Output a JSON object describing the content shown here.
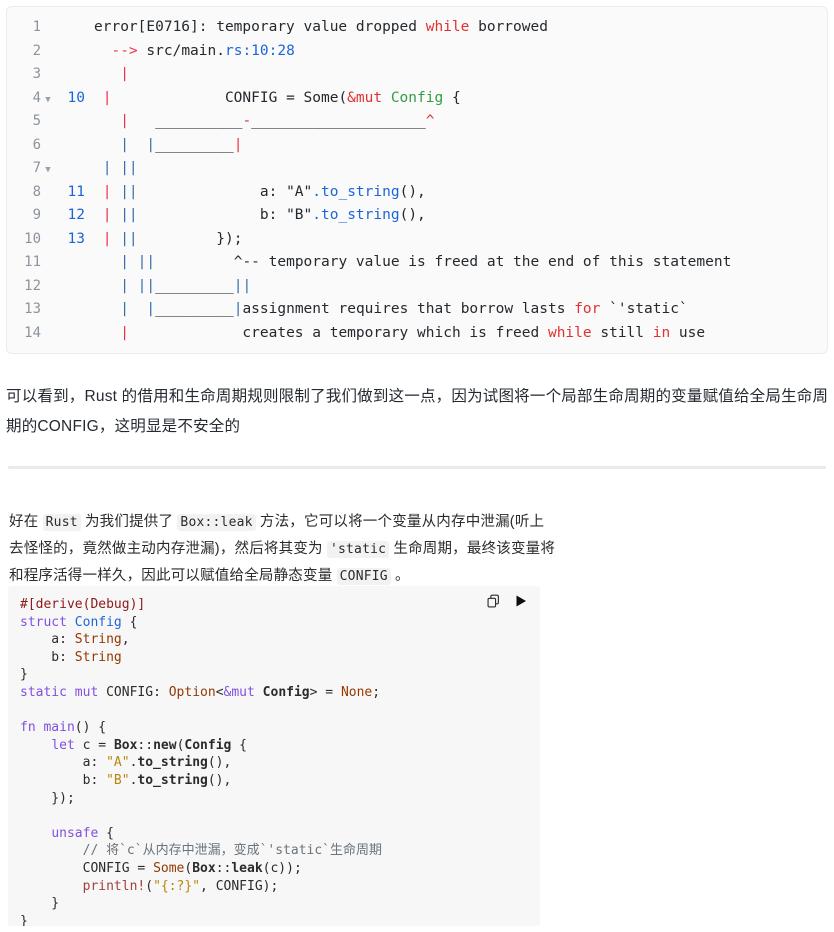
{
  "error_panel": {
    "name": "rust-compiler-error-output",
    "rows": [
      {
        "ln": "1",
        "fold": "",
        "src": "",
        "segments": [
          {
            "t": "error[E0716]: temporary value dropped ",
            "c": "tok-dark"
          },
          {
            "t": "while",
            "c": "kw-red"
          },
          {
            "t": " borrowed",
            "c": "tok-dark"
          }
        ]
      },
      {
        "ln": "2",
        "fold": "",
        "src": "",
        "segments": [
          {
            "t": "  ",
            "c": "tok-dark"
          },
          {
            "t": "-->",
            "c": "tok-pipe-red"
          },
          {
            "t": " src/main.",
            "c": "tok-dark"
          },
          {
            "t": "rs:10:28",
            "c": "tok-blue"
          }
        ]
      },
      {
        "ln": "3",
        "fold": "",
        "src": "",
        "segments": [
          {
            "t": "   ",
            "c": "tok-dark"
          },
          {
            "t": "|",
            "c": "tok-pipe-red"
          }
        ]
      },
      {
        "ln": "4",
        "fold": "▼",
        "src": "10",
        "segments": [
          {
            "t": " ",
            "c": "tok-dark"
          },
          {
            "t": "|",
            "c": "tok-pipe-red"
          },
          {
            "t": "             CONFIG = Some(",
            "c": "tok-dark"
          },
          {
            "t": "&mut",
            "c": "kw-red"
          },
          {
            "t": " ",
            "c": "tok-dark"
          },
          {
            "t": "Config",
            "c": "tok-green"
          },
          {
            "t": " {",
            "c": "tok-dark"
          }
        ]
      },
      {
        "ln": "5",
        "fold": "",
        "src": "",
        "segments": [
          {
            "t": "   ",
            "c": "tok-dark"
          },
          {
            "t": "|",
            "c": "tok-pipe-red"
          },
          {
            "t": "   __________",
            "c": "tok-dark"
          },
          {
            "t": "-",
            "c": "kw-red"
          },
          {
            "t": "____________________",
            "c": "tok-dark"
          },
          {
            "t": "^",
            "c": "kw-red"
          }
        ]
      },
      {
        "ln": "6",
        "fold": "",
        "src": "",
        "segments": [
          {
            "t": "   ",
            "c": "tok-dark"
          },
          {
            "t": "|",
            "c": "tok-pipe-blue"
          },
          {
            "t": "  ",
            "c": "tok-dark"
          },
          {
            "t": "|",
            "c": "tok-pipe-blue"
          },
          {
            "t": "_________",
            "c": "tok-dark"
          },
          {
            "t": "|",
            "c": "tok-pipe-red"
          }
        ]
      },
      {
        "ln": "7",
        "fold": "▼",
        "src": "",
        "segments": [
          {
            "t": " ",
            "c": "tok-dark"
          },
          {
            "t": "|",
            "c": "tok-pipe-blue"
          },
          {
            "t": " ",
            "c": "tok-dark"
          },
          {
            "t": "||",
            "c": "tok-pipe-blue"
          }
        ]
      },
      {
        "ln": "8",
        "fold": "",
        "src": "11",
        "segments": [
          {
            "t": " ",
            "c": "tok-dark"
          },
          {
            "t": "|",
            "c": "tok-pipe-red"
          },
          {
            "t": " ",
            "c": "tok-dark"
          },
          {
            "t": "||",
            "c": "tok-pipe-blue"
          },
          {
            "t": "              a: ",
            "c": "tok-dark"
          },
          {
            "t": "\"A\"",
            "c": "tok-dark"
          },
          {
            "t": ".to_string",
            "c": "tok-blue"
          },
          {
            "t": "(),",
            "c": "tok-dark"
          }
        ]
      },
      {
        "ln": "9",
        "fold": "",
        "src": "12",
        "segments": [
          {
            "t": " ",
            "c": "tok-dark"
          },
          {
            "t": "|",
            "c": "tok-pipe-red"
          },
          {
            "t": " ",
            "c": "tok-dark"
          },
          {
            "t": "||",
            "c": "tok-pipe-blue"
          },
          {
            "t": "              b: ",
            "c": "tok-dark"
          },
          {
            "t": "\"B\"",
            "c": "tok-dark"
          },
          {
            "t": ".to_string",
            "c": "tok-blue"
          },
          {
            "t": "(),",
            "c": "tok-dark"
          }
        ]
      },
      {
        "ln": "10",
        "fold": "",
        "src": "13",
        "segments": [
          {
            "t": " ",
            "c": "tok-dark"
          },
          {
            "t": "|",
            "c": "tok-pipe-red"
          },
          {
            "t": " ",
            "c": "tok-dark"
          },
          {
            "t": "||",
            "c": "tok-pipe-blue"
          },
          {
            "t": "         });",
            "c": "tok-dark"
          }
        ]
      },
      {
        "ln": "11",
        "fold": "",
        "src": "",
        "segments": [
          {
            "t": "   ",
            "c": "tok-dark"
          },
          {
            "t": "|",
            "c": "tok-pipe-blue"
          },
          {
            "t": " ",
            "c": "tok-dark"
          },
          {
            "t": "||",
            "c": "tok-pipe-blue"
          },
          {
            "t": "         ^-- temporary value is freed at the end of this statement",
            "c": "tok-dark"
          }
        ]
      },
      {
        "ln": "12",
        "fold": "",
        "src": "",
        "segments": [
          {
            "t": "   ",
            "c": "tok-dark"
          },
          {
            "t": "|",
            "c": "tok-pipe-blue"
          },
          {
            "t": " ",
            "c": "tok-dark"
          },
          {
            "t": "||",
            "c": "tok-pipe-blue"
          },
          {
            "t": "_________",
            "c": "tok-dark"
          },
          {
            "t": "||",
            "c": "tok-pipe-blue"
          }
        ]
      },
      {
        "ln": "13",
        "fold": "",
        "src": "",
        "segments": [
          {
            "t": "   ",
            "c": "tok-dark"
          },
          {
            "t": "|",
            "c": "tok-pipe-blue"
          },
          {
            "t": "  ",
            "c": "tok-dark"
          },
          {
            "t": "|",
            "c": "tok-pipe-blue"
          },
          {
            "t": "_________",
            "c": "tok-dark"
          },
          {
            "t": "|",
            "c": "tok-pipe-blue"
          },
          {
            "t": "assignment requires that borrow lasts ",
            "c": "tok-dark"
          },
          {
            "t": "for",
            "c": "kw-red"
          },
          {
            "t": " `'static`",
            "c": "tok-dark"
          }
        ]
      },
      {
        "ln": "14",
        "fold": "",
        "src": "",
        "segments": [
          {
            "t": "   ",
            "c": "tok-dark"
          },
          {
            "t": "|",
            "c": "tok-pipe-red"
          },
          {
            "t": "             creates a temporary which is freed ",
            "c": "tok-dark"
          },
          {
            "t": "while",
            "c": "kw-red"
          },
          {
            "t": " still ",
            "c": "tok-dark"
          },
          {
            "t": "in",
            "c": "kw-red"
          },
          {
            "t": " use",
            "c": "tok-dark"
          }
        ]
      }
    ]
  },
  "paragraph_1": {
    "text": "可以看到，Rust 的借用和生命周期规则限制了我们做到这一点，因为试图将一个局部生命周期的变量赋值给全局生命周期的CONFIG，这明显是不安全的"
  },
  "paragraph_2": {
    "segments": [
      {
        "t": "好在 ",
        "code": false
      },
      {
        "t": "Rust",
        "code": true
      },
      {
        "t": " 为我们提供了 ",
        "code": false
      },
      {
        "t": "Box::leak",
        "code": true
      },
      {
        "t": " 方法，它可以将一个变量从内存中泄漏(听上去怪怪的，竟然做主动内存泄漏)，然后将其变为 ",
        "code": false
      },
      {
        "t": "'static",
        "code": true
      },
      {
        "t": " 生命周期，最终该变量将和程序活得一样久，因此可以赋值给全局静态变量 ",
        "code": false
      },
      {
        "t": "CONFIG",
        "code": true
      },
      {
        "t": " 。",
        "code": false
      }
    ]
  },
  "code_block": {
    "language": "rust",
    "copy_label": "copy-code",
    "run_label": "run-code",
    "lines": [
      [
        {
          "t": "#[derive(Debug)]",
          "c": "c-attr"
        }
      ],
      [
        {
          "t": "struct",
          "c": "c-kw"
        },
        {
          "t": " ",
          "c": "c-name"
        },
        {
          "t": "Config",
          "c": "c-struct"
        },
        {
          "t": " {",
          "c": "c-punct"
        }
      ],
      [
        {
          "t": "    a: ",
          "c": "c-name"
        },
        {
          "t": "String",
          "c": "c-type"
        },
        {
          "t": ",",
          "c": "c-punct"
        }
      ],
      [
        {
          "t": "    b: ",
          "c": "c-name"
        },
        {
          "t": "String",
          "c": "c-type"
        }
      ],
      [
        {
          "t": "}",
          "c": "c-punct"
        }
      ],
      [
        {
          "t": "static",
          "c": "c-kw"
        },
        {
          "t": " ",
          "c": "c-name"
        },
        {
          "t": "mut",
          "c": "c-kw"
        },
        {
          "t": " CONFIG: ",
          "c": "c-name"
        },
        {
          "t": "Option",
          "c": "c-type"
        },
        {
          "t": "<",
          "c": "c-punct"
        },
        {
          "t": "&mut",
          "c": "c-amp"
        },
        {
          "t": " ",
          "c": "c-name"
        },
        {
          "t": "Config",
          "c": "c-bold"
        },
        {
          "t": "> = ",
          "c": "c-punct"
        },
        {
          "t": "None",
          "c": "c-type"
        },
        {
          "t": ";",
          "c": "c-punct"
        }
      ],
      [
        {
          "t": "",
          "c": "c-name"
        }
      ],
      [
        {
          "t": "fn",
          "c": "c-kw"
        },
        {
          "t": " ",
          "c": "c-name"
        },
        {
          "t": "main",
          "c": "c-fn"
        },
        {
          "t": "() {",
          "c": "c-punct"
        }
      ],
      [
        {
          "t": "    ",
          "c": "c-name"
        },
        {
          "t": "let",
          "c": "c-kw"
        },
        {
          "t": " c = ",
          "c": "c-name"
        },
        {
          "t": "Box",
          "c": "c-bold"
        },
        {
          "t": "::",
          "c": "c-punct"
        },
        {
          "t": "new",
          "c": "c-bold"
        },
        {
          "t": "(",
          "c": "c-punct"
        },
        {
          "t": "Config",
          "c": "c-bold"
        },
        {
          "t": " {",
          "c": "c-punct"
        }
      ],
      [
        {
          "t": "        a: ",
          "c": "c-name"
        },
        {
          "t": "\"A\"",
          "c": "c-str"
        },
        {
          "t": ".",
          "c": "c-punct"
        },
        {
          "t": "to_string",
          "c": "c-bold"
        },
        {
          "t": "(),",
          "c": "c-punct"
        }
      ],
      [
        {
          "t": "        b: ",
          "c": "c-name"
        },
        {
          "t": "\"B\"",
          "c": "c-str"
        },
        {
          "t": ".",
          "c": "c-punct"
        },
        {
          "t": "to_string",
          "c": "c-bold"
        },
        {
          "t": "(),",
          "c": "c-punct"
        }
      ],
      [
        {
          "t": "    });",
          "c": "c-punct"
        }
      ],
      [
        {
          "t": "",
          "c": "c-name"
        }
      ],
      [
        {
          "t": "    ",
          "c": "c-name"
        },
        {
          "t": "unsafe",
          "c": "c-kw"
        },
        {
          "t": " {",
          "c": "c-punct"
        }
      ],
      [
        {
          "t": "        // 将`c`从内存中泄漏，变成`'static`生命周期",
          "c": "c-comment"
        }
      ],
      [
        {
          "t": "        CONFIG = ",
          "c": "c-name"
        },
        {
          "t": "Some",
          "c": "c-type"
        },
        {
          "t": "(",
          "c": "c-punct"
        },
        {
          "t": "Box",
          "c": "c-bold"
        },
        {
          "t": "::",
          "c": "c-punct"
        },
        {
          "t": "leak",
          "c": "c-bold"
        },
        {
          "t": "(c));",
          "c": "c-punct"
        }
      ],
      [
        {
          "t": "        ",
          "c": "c-name"
        },
        {
          "t": "println!",
          "c": "c-macro"
        },
        {
          "t": "(",
          "c": "c-punct"
        },
        {
          "t": "\"{:?}\"",
          "c": "c-str"
        },
        {
          "t": ", CONFIG);",
          "c": "c-punct"
        }
      ],
      [
        {
          "t": "    }",
          "c": "c-punct"
        }
      ],
      [
        {
          "t": "}",
          "c": "c-punct"
        }
      ]
    ]
  },
  "colors": {
    "error_panel_bg": "#fafafa",
    "error_panel_border": "#ececec",
    "code_block_bg": "#f7f7f7",
    "divider": "#e8eaec",
    "keyword_red": "#e03131",
    "link_blue": "#1c65d9",
    "type_green": "#2f9e44",
    "text": "#252933"
  }
}
